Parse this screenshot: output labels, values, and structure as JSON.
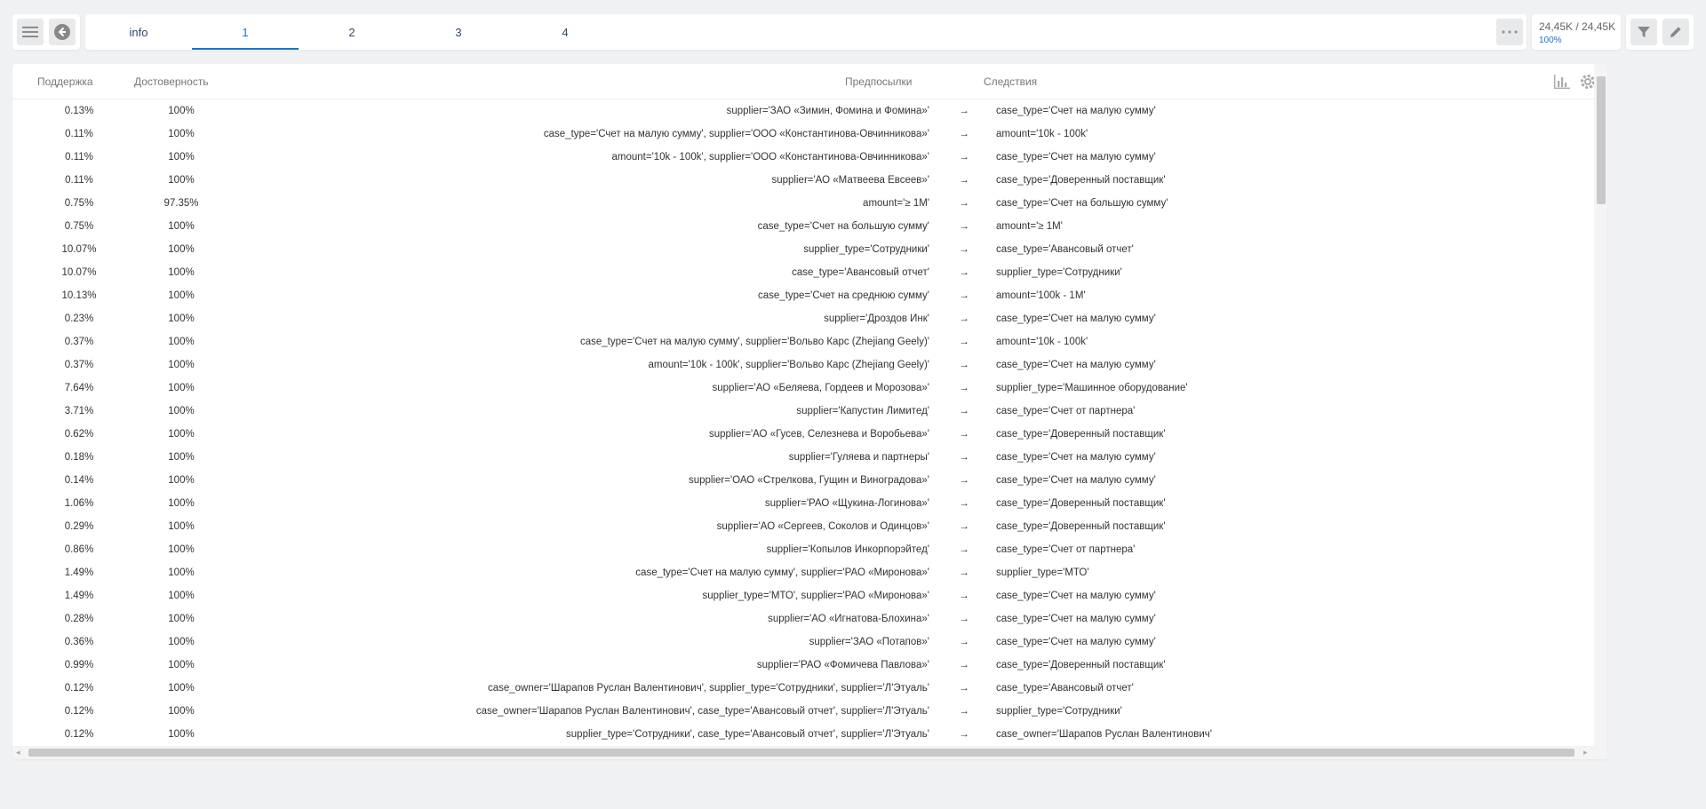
{
  "toolbar": {
    "menu_icon": "hamburger-menu-icon",
    "back_icon": "back-arrow-icon",
    "more_icon": "more-dots-icon",
    "filter_icon": "filter-icon",
    "edit_icon": "pencil-icon"
  },
  "tabs": [
    {
      "label": "info",
      "active": false
    },
    {
      "label": "1",
      "active": true
    },
    {
      "label": "2",
      "active": false
    },
    {
      "label": "3",
      "active": false
    },
    {
      "label": "4",
      "active": false
    }
  ],
  "counter": {
    "value": "24,45K / 24,45K",
    "percent": "100%"
  },
  "table": {
    "columns": {
      "support": "Поддержка",
      "confidence": "Достоверность",
      "antecedent": "Предпосылки",
      "consequent": "Следствия"
    },
    "arrow": "→",
    "rows": [
      [
        "0.13%",
        "100%",
        "supplier='ЗАО «Зимин, Фомина и Фомина»'",
        "case_type='Счет на малую сумму'"
      ],
      [
        "0.11%",
        "100%",
        "case_type='Счет на малую сумму', supplier='ООО «Константинова-Овчинникова»'",
        "amount='10k - 100k'"
      ],
      [
        "0.11%",
        "100%",
        "amount='10k - 100k', supplier='ООО «Константинова-Овчинникова»'",
        "case_type='Счет на малую сумму'"
      ],
      [
        "0.11%",
        "100%",
        "supplier='АО «Матвеева Евсеев»'",
        "case_type='Доверенный поставщик'"
      ],
      [
        "0.75%",
        "97.35%",
        "amount='≥ 1M'",
        "case_type='Счет на большую сумму'"
      ],
      [
        "0.75%",
        "100%",
        "case_type='Счет на большую сумму'",
        "amount='≥ 1M'"
      ],
      [
        "10.07%",
        "100%",
        "supplier_type='Сотрудники'",
        "case_type='Авансовый отчет'"
      ],
      [
        "10.07%",
        "100%",
        "case_type='Авансовый отчет'",
        "supplier_type='Сотрудники'"
      ],
      [
        "10.13%",
        "100%",
        "case_type='Счет на среднюю сумму'",
        "amount='100k - 1M'"
      ],
      [
        "0.23%",
        "100%",
        "supplier='Дроздов Инк'",
        "case_type='Счет на малую сумму'"
      ],
      [
        "0.37%",
        "100%",
        "case_type='Счет на малую сумму', supplier='Вольво Карс (Zhejiang Geely)'",
        "amount='10k - 100k'"
      ],
      [
        "0.37%",
        "100%",
        "amount='10k - 100k', supplier='Вольво Карс (Zhejiang Geely)'",
        "case_type='Счет на малую сумму'"
      ],
      [
        "7.64%",
        "100%",
        "supplier='АО «Беляева, Гордеев и Морозова»'",
        "supplier_type='Машинное оборудование'"
      ],
      [
        "3.71%",
        "100%",
        "supplier='Капустин Лимитед'",
        "case_type='Счет от партнера'"
      ],
      [
        "0.62%",
        "100%",
        "supplier='АО «Гусев, Селезнева и Воробьева»'",
        "case_type='Доверенный поставщик'"
      ],
      [
        "0.18%",
        "100%",
        "supplier='Гуляева и партнеры'",
        "case_type='Счет на малую сумму'"
      ],
      [
        "0.14%",
        "100%",
        "supplier='ОАО «Стрелкова, Гущин и Виноградова»'",
        "case_type='Счет на малую сумму'"
      ],
      [
        "1.06%",
        "100%",
        "supplier='РАО «Щукина-Логинова»'",
        "case_type='Доверенный поставщик'"
      ],
      [
        "0.29%",
        "100%",
        "supplier='АО «Сергеев, Соколов и Одинцов»'",
        "case_type='Доверенный поставщик'"
      ],
      [
        "0.86%",
        "100%",
        "supplier='Копылов Инкорпорэйтед'",
        "case_type='Счет от партнера'"
      ],
      [
        "1.49%",
        "100%",
        "case_type='Счет на малую сумму', supplier='РАО «Миронова»'",
        "supplier_type='МТО'"
      ],
      [
        "1.49%",
        "100%",
        "supplier_type='МТО', supplier='РАО «Миронова»'",
        "case_type='Счет на малую сумму'"
      ],
      [
        "0.28%",
        "100%",
        "supplier='АО «Игнатова-Блохина»'",
        "case_type='Счет на малую сумму'"
      ],
      [
        "0.36%",
        "100%",
        "supplier='ЗАО «Потапов»'",
        "case_type='Счет на малую сумму'"
      ],
      [
        "0.99%",
        "100%",
        "supplier='РАО «Фомичева Павлова»'",
        "case_type='Доверенный поставщик'"
      ],
      [
        "0.12%",
        "100%",
        "case_owner='Шарапов Руслан Валентинович', supplier_type='Сотрудники', supplier='Л'Этуаль'",
        "case_type='Авансовый отчет'"
      ],
      [
        "0.12%",
        "100%",
        "case_owner='Шарапов Руслан Валентинович', case_type='Авансовый отчет', supplier='Л'Этуаль'",
        "supplier_type='Сотрудники'"
      ],
      [
        "0.12%",
        "100%",
        "supplier_type='Сотрудники', case_type='Авансовый отчет', supplier='Л'Этуаль'",
        "case_owner='Шарапов Руслан Валентинович'"
      ]
    ]
  },
  "table_icons": {
    "chart": "bar-chart-icon",
    "settings": "gear-icon"
  }
}
